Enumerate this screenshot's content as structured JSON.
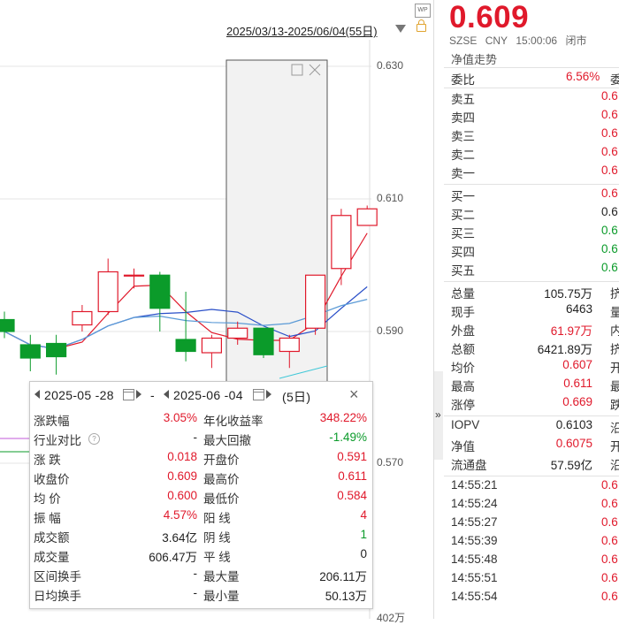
{
  "chart": {
    "date_range": "2025/03/13-2025/06/04(55日)",
    "y_ticks": [
      "0.630",
      "0.610",
      "0.590",
      "0.570"
    ],
    "bottom_tick_partial": "402万",
    "candles": [
      {
        "id": "c0",
        "open": 0.5918,
        "close": 0.59,
        "high": 0.593,
        "low": 0.589
      },
      {
        "id": "c1",
        "open": 0.588,
        "close": 0.586,
        "high": 0.5895,
        "low": 0.584
      },
      {
        "id": "c2",
        "open": 0.5882,
        "close": 0.5862,
        "high": 0.5895,
        "low": 0.5835
      },
      {
        "id": "c3",
        "open": 0.591,
        "close": 0.593,
        "high": 0.594,
        "low": 0.59
      },
      {
        "id": "c4",
        "open": 0.593,
        "close": 0.599,
        "high": 0.601,
        "low": 0.5925
      },
      {
        "id": "c5",
        "open": 0.5985,
        "close": 0.5985,
        "high": 0.5995,
        "low": 0.5965
      },
      {
        "id": "c6",
        "open": 0.5985,
        "close": 0.5935,
        "high": 0.599,
        "low": 0.59
      },
      {
        "id": "c7",
        "open": 0.5888,
        "close": 0.587,
        "high": 0.596,
        "low": 0.5855
      },
      {
        "id": "c8",
        "open": 0.5868,
        "close": 0.589,
        "high": 0.5895,
        "low": 0.5845
      },
      {
        "id": "c9",
        "open": 0.589,
        "close": 0.5905,
        "high": 0.5915,
        "low": 0.588
      },
      {
        "id": "c10",
        "open": 0.5905,
        "close": 0.5865,
        "high": 0.5905,
        "low": 0.586
      },
      {
        "id": "c11",
        "open": 0.587,
        "close": 0.589,
        "high": 0.5895,
        "low": 0.5845
      },
      {
        "id": "c12",
        "open": 0.5905,
        "close": 0.5985,
        "high": 0.5985,
        "low": 0.5895
      },
      {
        "id": "c13",
        "open": 0.5995,
        "close": 0.6075,
        "high": 0.6085,
        "low": 0.597
      },
      {
        "id": "c14",
        "open": 0.606,
        "close": 0.6085,
        "high": 0.609,
        "low": 0.606
      }
    ]
  },
  "popup": {
    "start_date": "2025-05 -28",
    "sep": "-",
    "end_date": "2025-06 -04",
    "days": "(5日)",
    "rows": [
      {
        "l1": "涨跌幅",
        "v1": "3.05%",
        "c1": "red",
        "l2": "年化收益率",
        "v2": "348.22%",
        "c2": "red"
      },
      {
        "l1": "行业对比",
        "v1": "-",
        "c1": "dark",
        "l2": "最大回撤",
        "v2": "-1.49%",
        "c2": "green",
        "help": "?"
      },
      {
        "l1": "涨 跌",
        "v1": "0.018",
        "c1": "red",
        "l2": "开盘价",
        "v2": "0.591",
        "c2": "red"
      },
      {
        "l1": "收盘价",
        "v1": "0.609",
        "c1": "red",
        "l2": "最高价",
        "v2": "0.611",
        "c2": "red"
      },
      {
        "l1": "均 价",
        "v1": "0.600",
        "c1": "red",
        "l2": "最低价",
        "v2": "0.584",
        "c2": "red"
      },
      {
        "l1": "振 幅",
        "v1": "4.57%",
        "c1": "red",
        "l2": "阳 线",
        "v2": "4",
        "c2": "red"
      },
      {
        "l1": "成交额",
        "v1": "3.64亿",
        "c1": "dark",
        "l2": "阴 线",
        "v2": "1",
        "c2": "green"
      },
      {
        "l1": "成交量",
        "v1": "606.47万",
        "c1": "dark",
        "l2": "平 线",
        "v2": "0",
        "c2": "dark"
      },
      {
        "l1": "区间换手",
        "v1": "-",
        "c1": "dark",
        "l2": "最大量",
        "v2": "206.11万",
        "c2": "dark"
      },
      {
        "l1": "日均换手",
        "v1": "-",
        "c1": "dark",
        "l2": "最小量",
        "v2": "50.13万",
        "c2": "dark"
      }
    ]
  },
  "quote": {
    "price": "0.609",
    "exchange": "SZSE",
    "currency": "CNY",
    "time": "15:00:06",
    "status": "闭市",
    "nav_trend": "净值走势",
    "weibi_label": "委比",
    "weibi_value": "6.56%",
    "weibi_extra": "委",
    "asks": [
      {
        "label": "卖五",
        "value": "0.6"
      },
      {
        "label": "卖四",
        "value": "0.6"
      },
      {
        "label": "卖三",
        "value": "0.6"
      },
      {
        "label": "卖二",
        "value": "0.6"
      },
      {
        "label": "卖一",
        "value": "0.6"
      }
    ],
    "bids": [
      {
        "label": "买一",
        "value": "0.6",
        "color": "red"
      },
      {
        "label": "买二",
        "value": "0.6",
        "color": "dark"
      },
      {
        "label": "买三",
        "value": "0.6",
        "color": "green"
      },
      {
        "label": "买四",
        "value": "0.6",
        "color": "green"
      },
      {
        "label": "买五",
        "value": "0.6",
        "color": "green"
      }
    ],
    "stats": [
      {
        "label": "总量",
        "value": "105.75万",
        "color": "dark",
        "extra": "挤"
      },
      {
        "label": "现手",
        "value": "6463",
        "color": "dark",
        "extra": "量"
      },
      {
        "label": "外盘",
        "value": "61.97万",
        "color": "red",
        "extra": "内"
      },
      {
        "label": "总额",
        "value": "6421.89万",
        "color": "dark",
        "extra": "挤"
      },
      {
        "label": "均价",
        "value": "0.607",
        "color": "red",
        "extra": "开"
      },
      {
        "label": "最高",
        "value": "0.611",
        "color": "red",
        "extra": "最"
      },
      {
        "label": "涨停",
        "value": "0.669",
        "color": "red",
        "extra": "跌"
      }
    ],
    "fund": [
      {
        "label": "IOPV",
        "value": "0.6103",
        "color": "dark",
        "extra": "沿"
      },
      {
        "label": "净值",
        "value": "0.6075",
        "color": "red",
        "extra": "开"
      },
      {
        "label": "流通盘",
        "value": "57.59亿",
        "color": "dark",
        "extra": "沿"
      }
    ],
    "ticks": [
      {
        "time": "14:55:21",
        "value": "0.6"
      },
      {
        "time": "14:55:24",
        "value": "0.6"
      },
      {
        "time": "14:55:27",
        "value": "0.6"
      },
      {
        "time": "14:55:39",
        "value": "0.6"
      },
      {
        "time": "14:55:48",
        "value": "0.6"
      },
      {
        "time": "14:55:51",
        "value": "0.6"
      },
      {
        "time": "14:55:54",
        "value": "0.6"
      }
    ]
  },
  "colors": {
    "up": "#e0192b",
    "down": "#0b9b2a",
    "ma5": "#e0192b",
    "ma10": "#2a4fc8",
    "ma20": "#5a9ad6"
  },
  "icons": {
    "expander": "»",
    "close": "×"
  }
}
